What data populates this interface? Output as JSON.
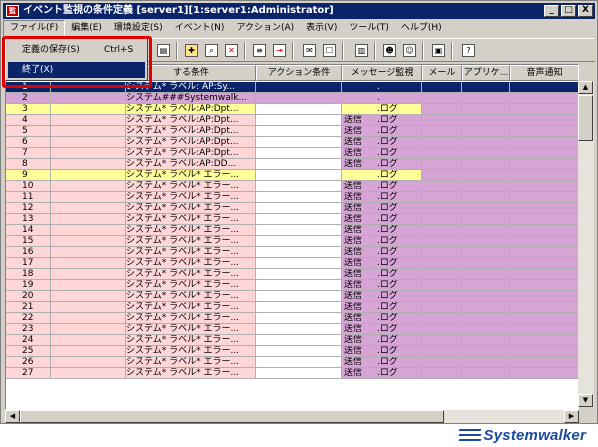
{
  "window": {
    "title": "イベント監視の条件定義 [server1][1:server1:Administrator]",
    "icon_text": "監",
    "buttons": [
      "_",
      "□",
      "X"
    ]
  },
  "menu": {
    "items": [
      "ファイル(F)",
      "編集(E)",
      "環境設定(S)",
      "イベント(N)",
      "アクション(A)",
      "表示(V)",
      "ツール(T)",
      "ヘルプ(H)"
    ]
  },
  "file_menu": {
    "save_label": "定義の保存(S)",
    "save_shortcut": "Ctrl+S",
    "exit_label": "終了(X)"
  },
  "grid": {
    "headers": [
      "",
      "する条件",
      "アクション条件",
      "メッセージ監視",
      "メール",
      "アプリケ...",
      "音声通知"
    ],
    "rows": [
      {
        "no": "1",
        "cond": "システム* ラベル: AP:Sy...",
        "msg1": "",
        "msg2": ".",
        "style": "selected"
      },
      {
        "no": "2",
        "cond": "システム###Systemwalk...",
        "msg1": "",
        "msg2": ".",
        "style": "purple"
      },
      {
        "no": "3",
        "cond": "システム* ラベル:AP:Dpt...",
        "msg1": "",
        "msg2": ".ログ",
        "style": "yellow"
      },
      {
        "no": "4",
        "cond": "システム* ラベル:AP:Dpt...",
        "msg1": "送信",
        "msg2": ".ログ",
        "style": "pink"
      },
      {
        "no": "5",
        "cond": "システム* ラベル:AP:Dpt...",
        "msg1": "送信",
        "msg2": ".ログ",
        "style": "pink"
      },
      {
        "no": "6",
        "cond": "システム* ラベル:AP:Dpt...",
        "msg1": "送信",
        "msg2": ".ログ",
        "style": "pink"
      },
      {
        "no": "7",
        "cond": "システム* ラベル:AP:Dpt...",
        "msg1": "送信",
        "msg2": ".ログ",
        "style": "pink"
      },
      {
        "no": "8",
        "cond": "システム* ラベル:AP:DD...",
        "msg1": "送信",
        "msg2": ".ログ",
        "style": "pink"
      },
      {
        "no": "9",
        "cond": "システム* ラベル* エラー...",
        "msg1": "",
        "msg2": ".ログ",
        "style": "yellow"
      },
      {
        "no": "10",
        "cond": "システム* ラベル* エラー...",
        "msg1": "送信",
        "msg2": ".ログ",
        "style": "pink"
      },
      {
        "no": "11",
        "cond": "システム* ラベル* エラー...",
        "msg1": "送信",
        "msg2": ".ログ",
        "style": "pink"
      },
      {
        "no": "12",
        "cond": "システム* ラベル* エラー...",
        "msg1": "送信",
        "msg2": ".ログ",
        "style": "pink"
      },
      {
        "no": "13",
        "cond": "システム* ラベル* エラー...",
        "msg1": "送信",
        "msg2": ".ログ",
        "style": "pink"
      },
      {
        "no": "14",
        "cond": "システム* ラベル* エラー...",
        "msg1": "送信",
        "msg2": ".ログ",
        "style": "pink"
      },
      {
        "no": "15",
        "cond": "システム* ラベル* エラー...",
        "msg1": "送信",
        "msg2": ".ログ",
        "style": "pink"
      },
      {
        "no": "16",
        "cond": "システム* ラベル* エラー...",
        "msg1": "送信",
        "msg2": ".ログ",
        "style": "pink"
      },
      {
        "no": "17",
        "cond": "システム* ラベル* エラー...",
        "msg1": "送信",
        "msg2": ".ログ",
        "style": "pink"
      },
      {
        "no": "18",
        "cond": "システム* ラベル* エラー...",
        "msg1": "送信",
        "msg2": ".ログ",
        "style": "pink"
      },
      {
        "no": "19",
        "cond": "システム* ラベル* エラー...",
        "msg1": "送信",
        "msg2": ".ログ",
        "style": "pink"
      },
      {
        "no": "20",
        "cond": "システム* ラベル* エラー...",
        "msg1": "送信",
        "msg2": ".ログ",
        "style": "pink"
      },
      {
        "no": "21",
        "cond": "システム* ラベル* エラー...",
        "msg1": "送信",
        "msg2": ".ログ",
        "style": "pink"
      },
      {
        "no": "22",
        "cond": "システム* ラベル* エラー...",
        "msg1": "送信",
        "msg2": ".ログ",
        "style": "pink"
      },
      {
        "no": "23",
        "cond": "システム* ラベル* エラー...",
        "msg1": "送信",
        "msg2": ".ログ",
        "style": "pink"
      },
      {
        "no": "24",
        "cond": "システム* ラベル* エラー...",
        "msg1": "送信",
        "msg2": ".ログ",
        "style": "pink"
      },
      {
        "no": "25",
        "cond": "システム* ラベル* エラー...",
        "msg1": "送信",
        "msg2": ".ログ",
        "style": "pink"
      },
      {
        "no": "26",
        "cond": "システム* ラベル* エラー...",
        "msg1": "送信",
        "msg2": ".ログ",
        "style": "pink"
      },
      {
        "no": "27",
        "cond": "システム* ラベル* エラー...",
        "msg1": "送信",
        "msg2": ".ログ",
        "style": "pink"
      }
    ]
  },
  "colors": {
    "pink": "#ffd6d8",
    "purple": "#d7a4d6",
    "yellow": "#ffff99",
    "selected": "#0a246a",
    "white": "#ffffff",
    "highlight_border": "#e00000"
  },
  "icons": [
    "cut-icon",
    "copy-icon",
    "paste-icon",
    "new-row-icon",
    "delete-row-icon",
    "find-icon",
    "filter-icon",
    "message-icon",
    "apply-icon",
    "document-icon",
    "user-icon",
    "user-group-icon",
    "book-icon",
    "help-icon"
  ],
  "brand": {
    "logo_text": "Systemwalker"
  }
}
